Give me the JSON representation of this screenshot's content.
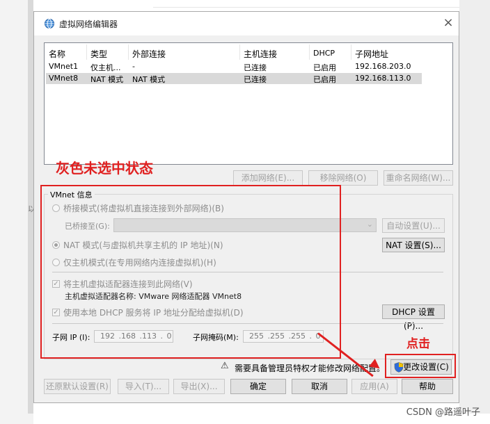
{
  "window": {
    "title": "虚拟网络编辑器",
    "close_label": "×"
  },
  "background": {
    "edge_char": "以"
  },
  "network_list": {
    "columns": [
      "名称",
      "类型",
      "外部连接",
      "主机连接",
      "DHCP",
      "子网地址"
    ],
    "rows": [
      {
        "name": "VMnet1",
        "type": "仅主机...",
        "external": "-",
        "host": "已连接",
        "dhcp": "已启用",
        "subnet": "192.168.203.0",
        "selected": false
      },
      {
        "name": "VMnet8",
        "type": "NAT 模式",
        "external": "NAT 模式",
        "host": "已连接",
        "dhcp": "已启用",
        "subnet": "192.168.113.0",
        "selected": true
      }
    ]
  },
  "list_buttons": {
    "add": "添加网络(E)...",
    "remove": "移除网络(O)",
    "rename": "重命名网络(W)..."
  },
  "vmnet_info": {
    "group_title": "VMnet 信息",
    "bridged_label": "桥接模式(将虚拟机直接连接到外部网络)(B)",
    "bridged_to_label": "已桥接至(G):",
    "auto_settings": "自动设置(U)...",
    "nat_label": "NAT 模式(与虚拟机共享主机的 IP 地址)(N)",
    "nat_settings": "NAT 设置(S)...",
    "hostonly_label": "仅主机模式(在专用网络内连接虚拟机)(H)",
    "connect_adapter_label": "将主机虚拟适配器连接到此网络(V)",
    "adapter_name": "主机虚拟适配器名称: VMware 网络适配器 VMnet8",
    "dhcp_label": "使用本地 DHCP 服务将 IP 地址分配给虚拟机(D)",
    "dhcp_settings": "DHCP 设置(P)...",
    "subnet_ip_label": "子网 IP (I):",
    "subnet_ip": "192 .168 .113 . 0",
    "subnet_mask_label": "子网掩码(M):",
    "subnet_mask": "255 .255 .255 . 0"
  },
  "admin": {
    "warning_icon": "⚠",
    "warning_text": "需要具备管理员特权才能修改网络配置。",
    "change_settings": "更改设置(C)"
  },
  "bottom_buttons": {
    "restore": "还原默认设置(R)",
    "import": "导入(T)...",
    "export": "导出(X)...",
    "ok": "确定",
    "cancel": "取消",
    "apply": "应用(A)",
    "help": "帮助"
  },
  "annotations": {
    "gray_state": "灰色未选中状态",
    "click": "点击",
    "color": "#e02020"
  },
  "watermark": "CSDN @路遥叶子"
}
